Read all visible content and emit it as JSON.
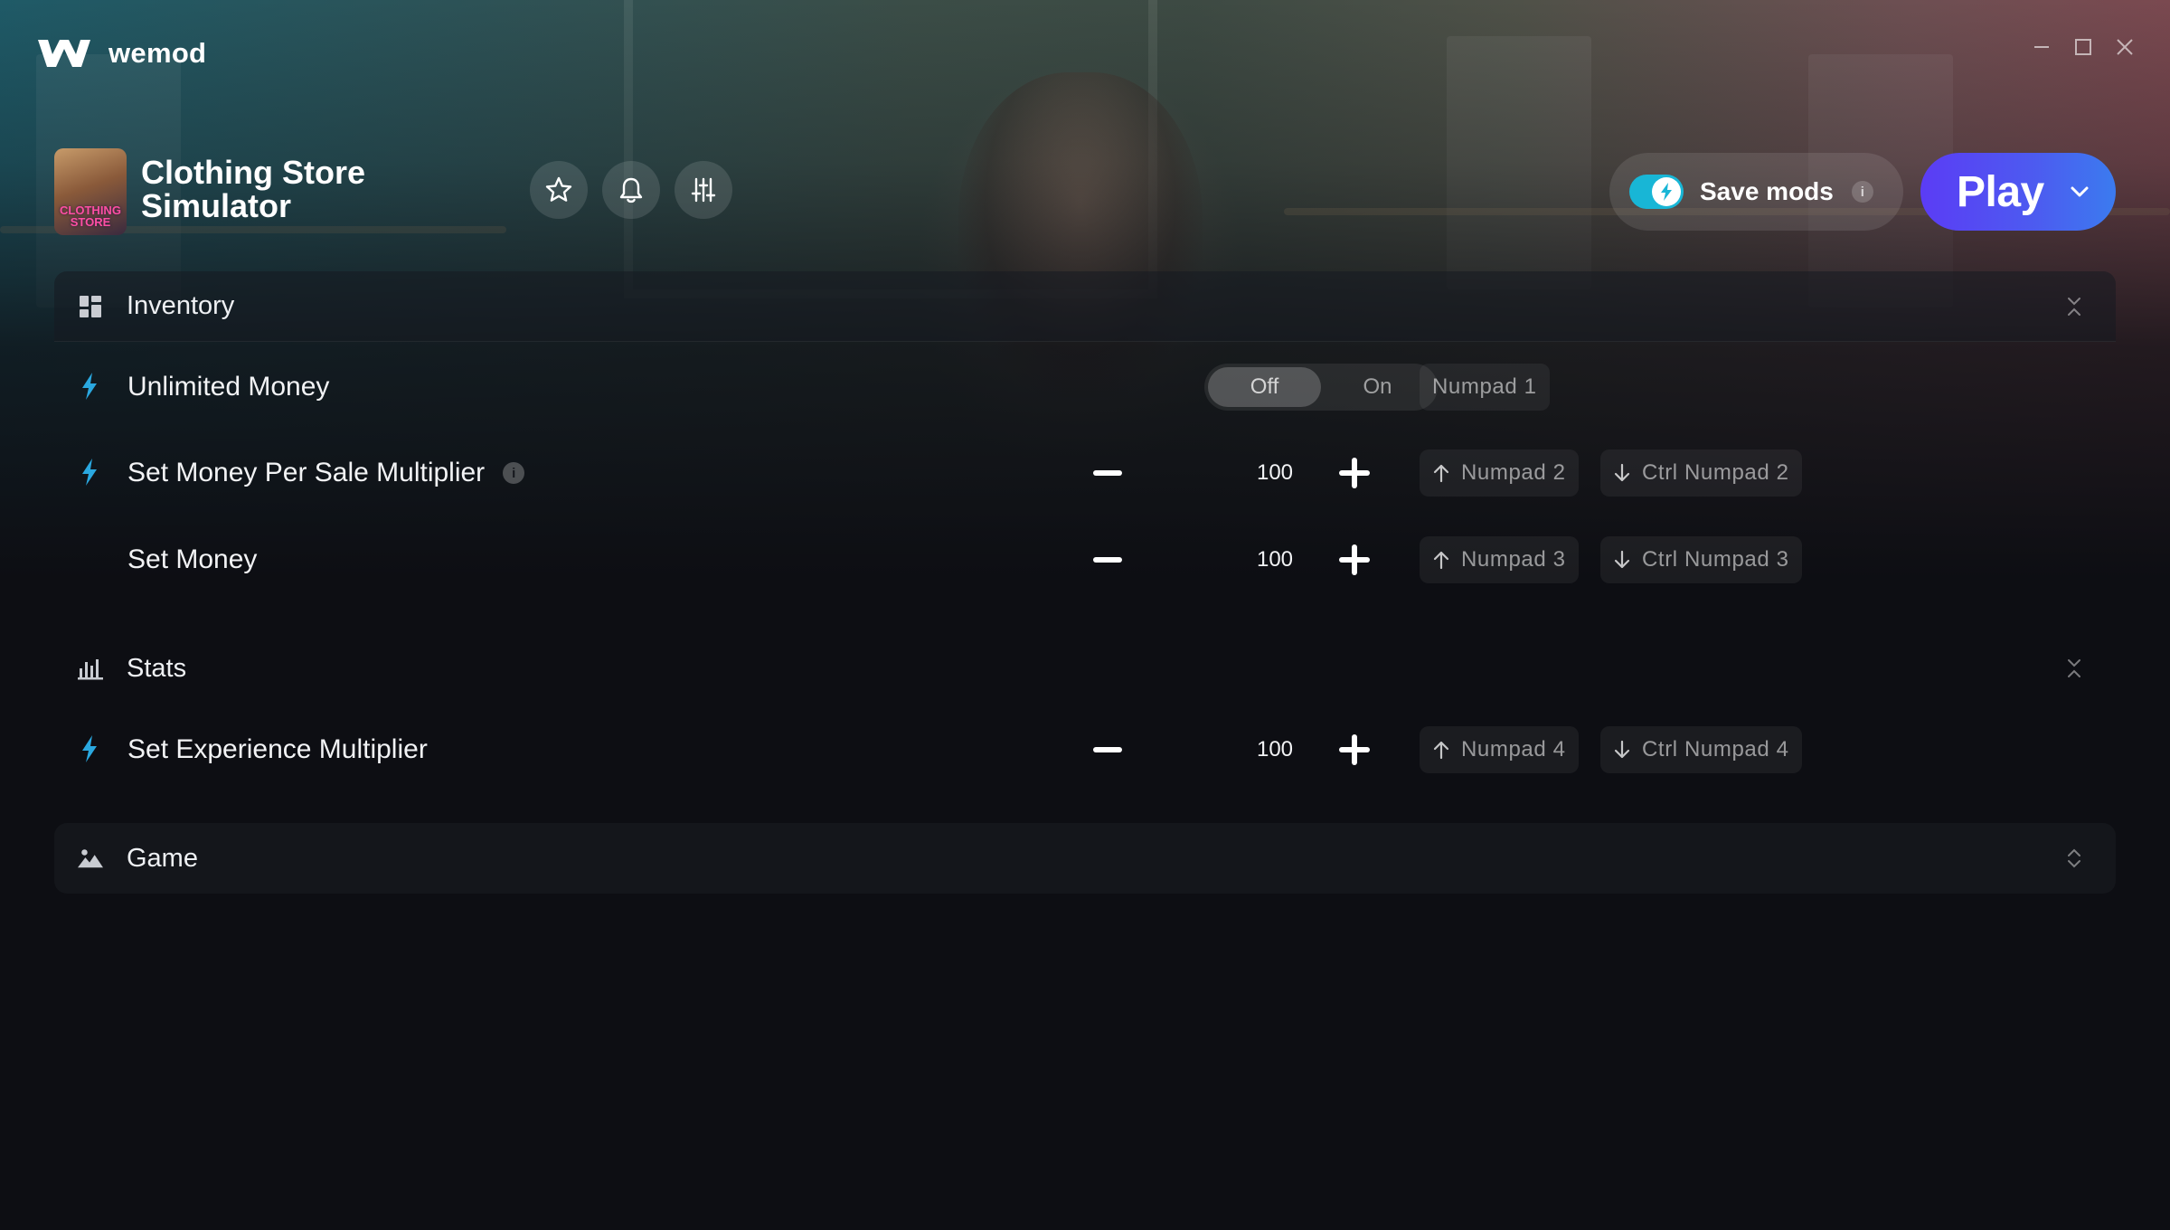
{
  "app": {
    "name": "wemod"
  },
  "window_controls": {
    "minimize_icon": "minimize-icon",
    "maximize_icon": "maximize-icon",
    "close_icon": "close-icon"
  },
  "game": {
    "title": "Clothing Store\nSimulator",
    "thumbnail_text": "CLOTHING\nSTORE",
    "actions": [
      "star-icon",
      "bell-icon",
      "sliders-icon"
    ]
  },
  "save_mods": {
    "label": "Save mods",
    "enabled": true,
    "info": "i"
  },
  "play": {
    "label": "Play"
  },
  "colors": {
    "accent_toggle": "#18b6d6",
    "play_gradient_start": "#5b3cf5",
    "play_gradient_end": "#3b7bef",
    "bolt": "#2aa8e0",
    "background": "#0d0e13"
  },
  "sections": {
    "inventory": {
      "label": "Inventory",
      "icon": "grid-icon",
      "mods": {
        "unlimited_money": {
          "label": "Unlimited Money",
          "type": "toggle",
          "off_label": "Off",
          "on_label": "On",
          "state": "Off",
          "hotkey": "Numpad 1"
        },
        "money_per_sale": {
          "label": "Set Money Per Sale Multiplier",
          "info": "i",
          "type": "slider",
          "value": "100",
          "hotkey_up": "Numpad 2",
          "hotkey_down": "Ctrl Numpad 2"
        },
        "set_money": {
          "label": "Set Money",
          "type": "number",
          "value": "100",
          "hotkey_up": "Numpad 3",
          "hotkey_down": "Ctrl Numpad 3"
        }
      }
    },
    "stats": {
      "label": "Stats",
      "icon": "bar-chart-icon",
      "mods": {
        "experience_multiplier": {
          "label": "Set Experience Multiplier",
          "type": "slider",
          "value": "100",
          "hotkey_up": "Numpad 4",
          "hotkey_down": "Ctrl Numpad 4"
        }
      }
    },
    "game": {
      "label": "Game",
      "icon": "mountain-icon"
    }
  }
}
